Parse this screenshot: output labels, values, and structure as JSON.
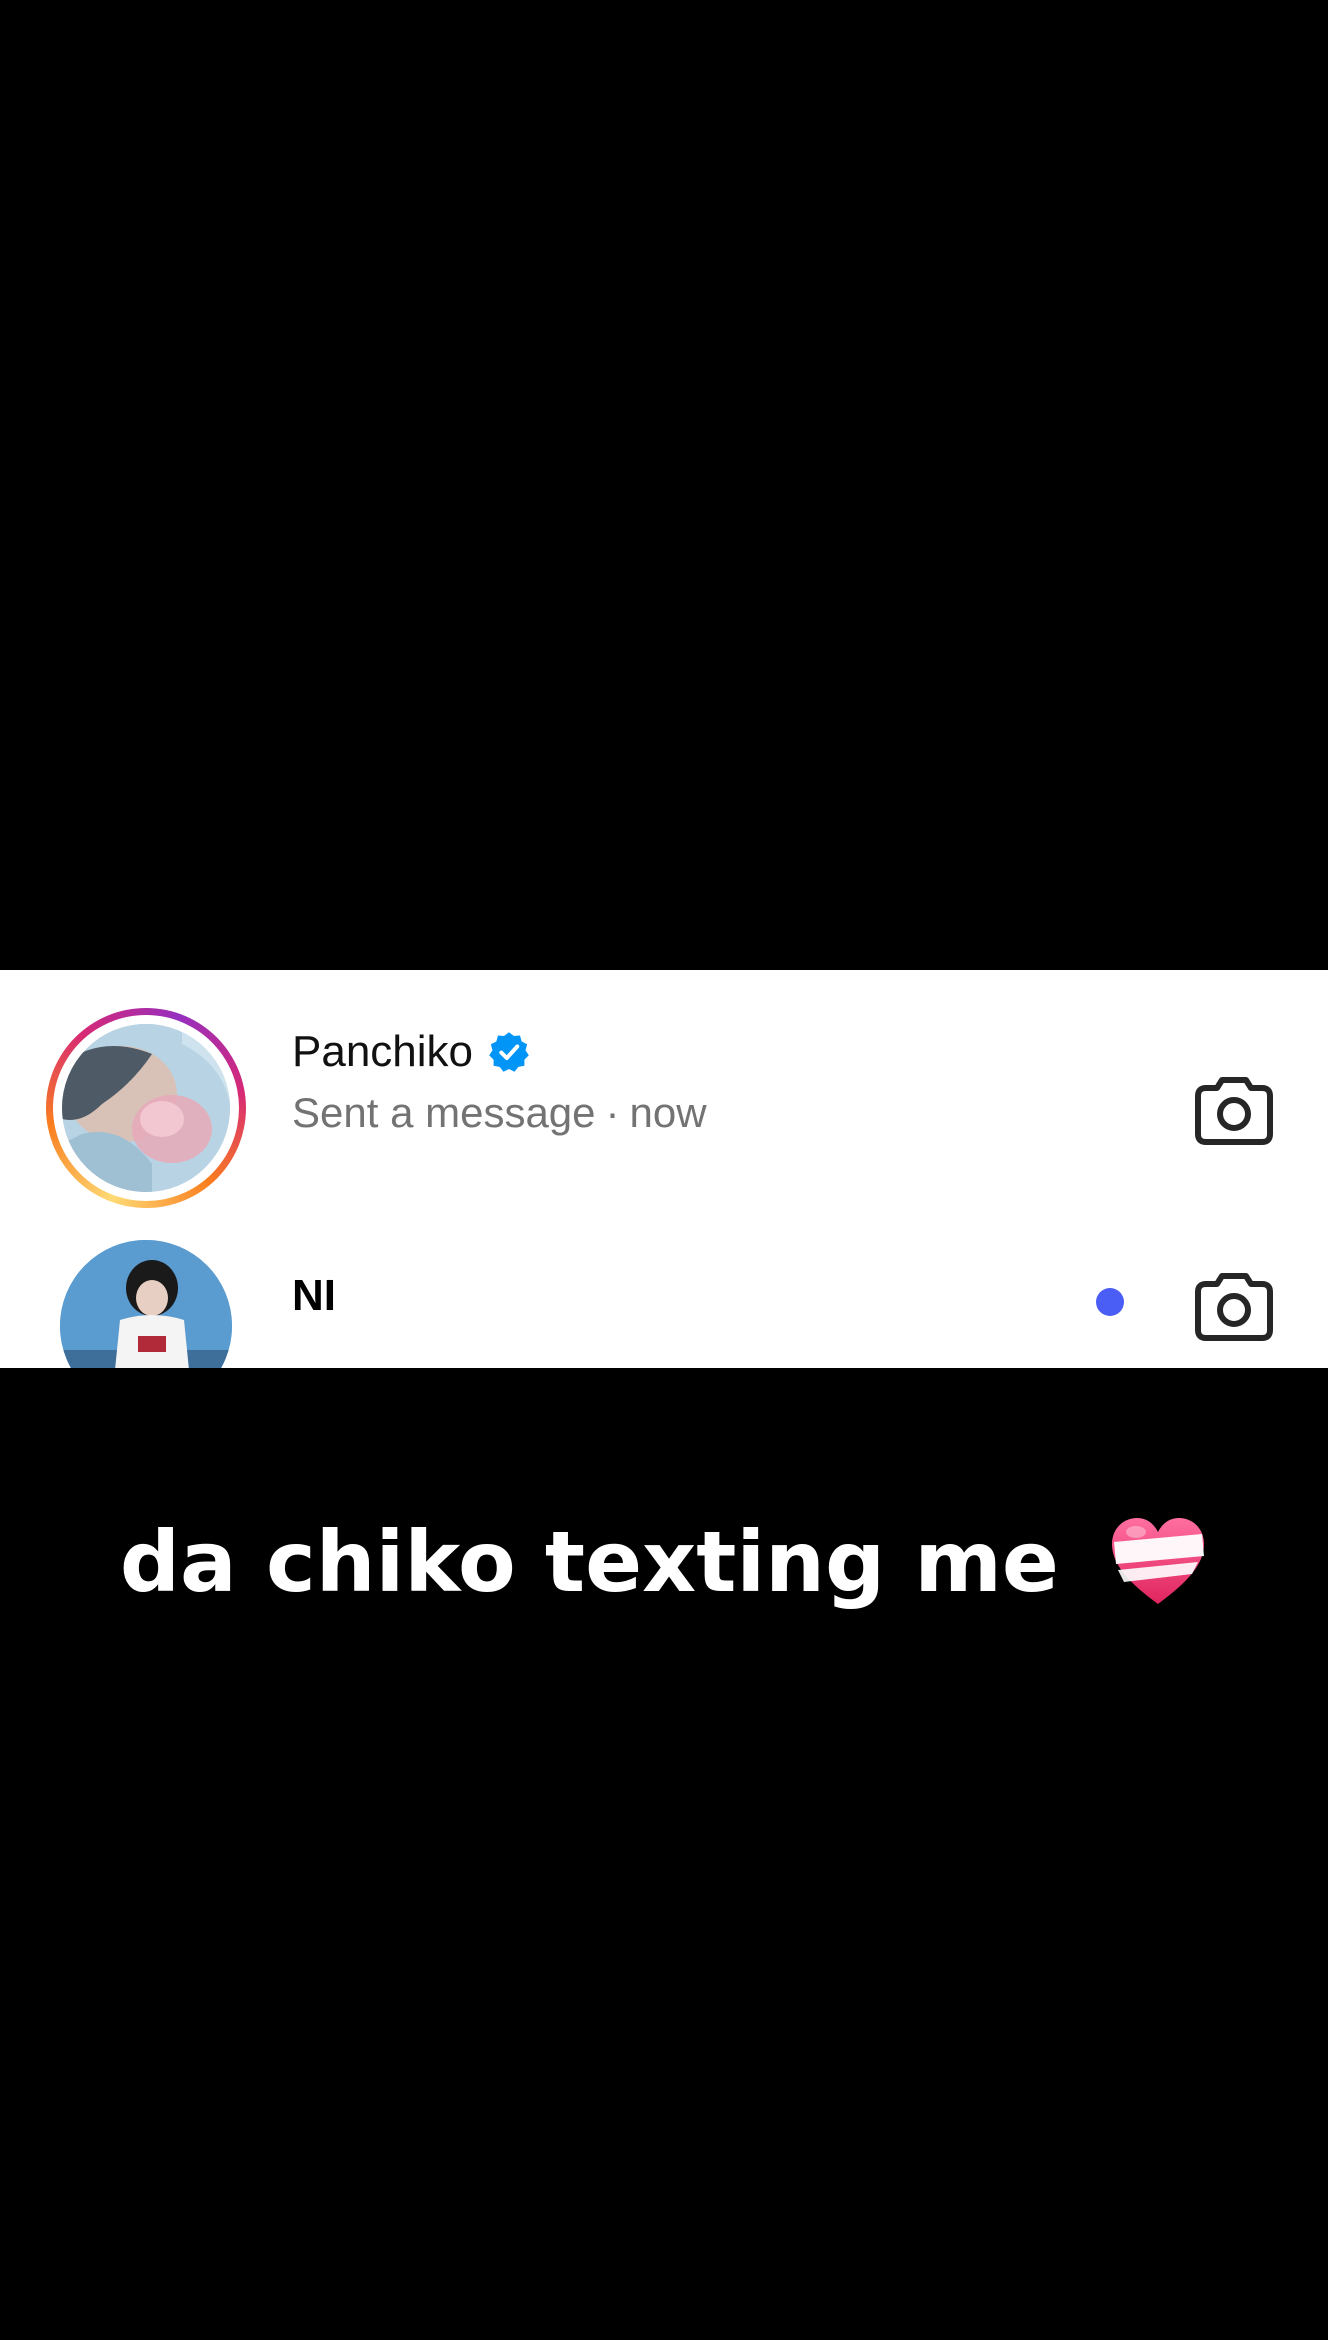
{
  "threads": [
    {
      "username": "Panchiko",
      "verified": true,
      "has_story_ring": true,
      "preview_text": "Sent a message",
      "separator": "·",
      "time": "now",
      "action_icon": "camera-icon"
    },
    {
      "username": "NI",
      "verified": false,
      "has_story_ring": false,
      "unread": true,
      "action_icon": "camera-icon"
    }
  ],
  "caption": {
    "text": "da chiko texting me",
    "emoji": "mending-heart-icon"
  },
  "colors": {
    "background": "#000000",
    "panel": "#ffffff",
    "verified_blue": "#0095f6",
    "unread_dot": "#4a5df5",
    "muted_text": "#737373"
  }
}
